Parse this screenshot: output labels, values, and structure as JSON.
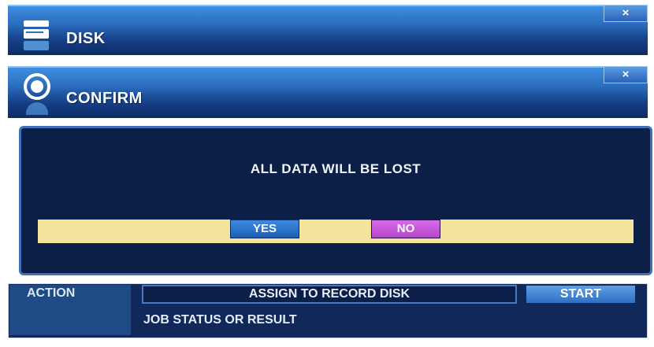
{
  "disk_window": {
    "title": "DISK",
    "close_label": "×",
    "icon": "disk-icon"
  },
  "confirm_window": {
    "title": "CONFIRM",
    "close_label": "×",
    "icon": "radio-icon",
    "message": "ALL DATA WILL BE LOST",
    "yes_label": "YES",
    "no_label": "NO"
  },
  "disk_panel": {
    "action_label": "ACTION",
    "action_value": "ASSIGN TO RECORD DISK",
    "start_label": "START",
    "status_label": "JOB STATUS OR RESULT"
  },
  "colors": {
    "title_bar": "#2c6ec0",
    "dialog_bg": "#0b1f47",
    "button_bar": "#f4e39a",
    "yes_button": "#2f74cc",
    "no_button": "#c657da"
  }
}
